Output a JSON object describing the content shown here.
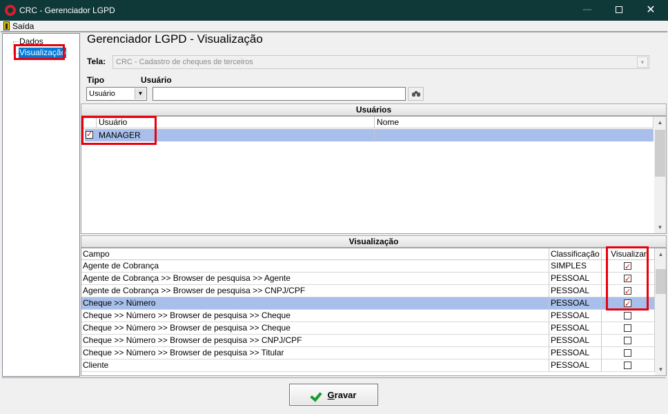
{
  "window": {
    "title": "CRC - Gerenciador LGPD"
  },
  "menu": {
    "exit": "Saída"
  },
  "tree": {
    "items": [
      "Dados",
      "Visualização"
    ]
  },
  "header": {
    "title": "Gerenciador LGPD - Visualização",
    "tela_label": "Tela:",
    "tela_value": "CRC - Cadastro de cheques de terceiros",
    "tipo_label": "Tipo",
    "usuario_label": "Usuário",
    "tipo_value": "Usuário",
    "usuario_value": ""
  },
  "users": {
    "group_title": "Usuários",
    "columns": [
      "Usuário",
      "Nome"
    ],
    "rows": [
      {
        "checked": true,
        "usuario": "MANAGER",
        "nome": ""
      }
    ]
  },
  "visualizacao": {
    "group_title": "Visualização",
    "columns": [
      "Campo",
      "Classificação",
      "Visualizar"
    ],
    "rows": [
      {
        "campo": "Agente de Cobrança",
        "classificacao": "SIMPLES",
        "visualizar": true
      },
      {
        "campo": "Agente de Cobrança >> Browser de pesquisa >> Agente",
        "classificacao": "PESSOAL",
        "visualizar": true
      },
      {
        "campo": "Agente de Cobrança >> Browser de pesquisa >> CNPJ/CPF",
        "classificacao": "PESSOAL",
        "visualizar": true
      },
      {
        "campo": "Cheque >> Número",
        "classificacao": "PESSOAL",
        "visualizar": true,
        "selected": true
      },
      {
        "campo": "Cheque >> Número >> Browser de pesquisa >> Cheque",
        "classificacao": "PESSOAL",
        "visualizar": false
      },
      {
        "campo": "Cheque >> Número >> Browser de pesquisa >> Cheque",
        "classificacao": "PESSOAL",
        "visualizar": false
      },
      {
        "campo": "Cheque >> Número >> Browser de pesquisa >> CNPJ/CPF",
        "classificacao": "PESSOAL",
        "visualizar": false
      },
      {
        "campo": "Cheque >> Número >> Browser de pesquisa >> Titular",
        "classificacao": "PESSOAL",
        "visualizar": false
      },
      {
        "campo": "Cliente",
        "classificacao": "PESSOAL",
        "visualizar": false
      }
    ]
  },
  "footer": {
    "save_label_mnemonic": "G",
    "save_label_rest": "ravar"
  },
  "colors": {
    "titlebar": "#0f3838",
    "selection": "#a7bfea",
    "highlight": "#e8000b",
    "tree_selection": "#0078d7"
  }
}
